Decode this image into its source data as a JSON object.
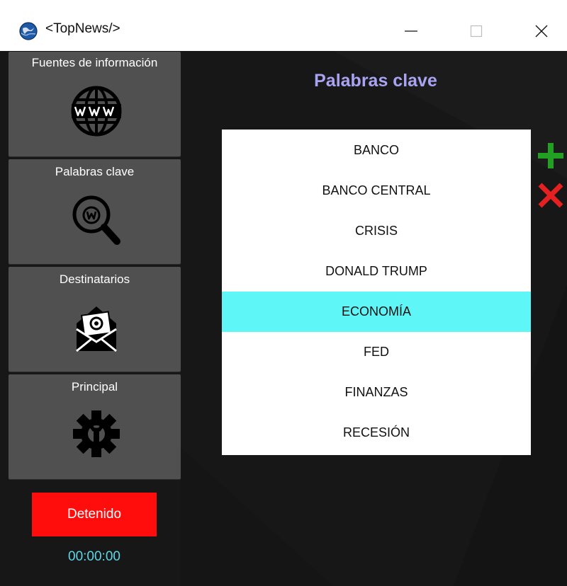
{
  "window": {
    "title": "<TopNews/>",
    "controls": [
      "minimize-button",
      "maximize-button",
      "close-button"
    ]
  },
  "sidebar": {
    "items": [
      {
        "label": "Fuentes de información",
        "icon": "globe-www-icon"
      },
      {
        "label": "Palabras clave",
        "icon": "keyword-search-icon"
      },
      {
        "label": "Destinatarios",
        "icon": "email-envelope-icon"
      },
      {
        "label": "Principal",
        "icon": "gear-wrench-icon"
      }
    ],
    "status_label": "Detenido",
    "timer": "00:00:00"
  },
  "main": {
    "title": "Palabras clave",
    "keywords": [
      "BANCO",
      "BANCO CENTRAL",
      "CRISIS",
      "DONALD TRUMP",
      "ECONOMÍA",
      "FED",
      "FINANZAS",
      "RECESIÓN"
    ],
    "selected_keyword": "ECONOMÍA",
    "actions": {
      "add_icon": "plus-icon",
      "remove_icon": "x-icon"
    }
  },
  "colors": {
    "background": "#171717",
    "sidebar_button": "#505050",
    "title_accent": "#a9a4f2",
    "selection": "#5ff6f8",
    "status_stopped": "#ff0d0d",
    "timer": "#5fd6e6",
    "add": "#22a022",
    "remove": "#e52020"
  }
}
